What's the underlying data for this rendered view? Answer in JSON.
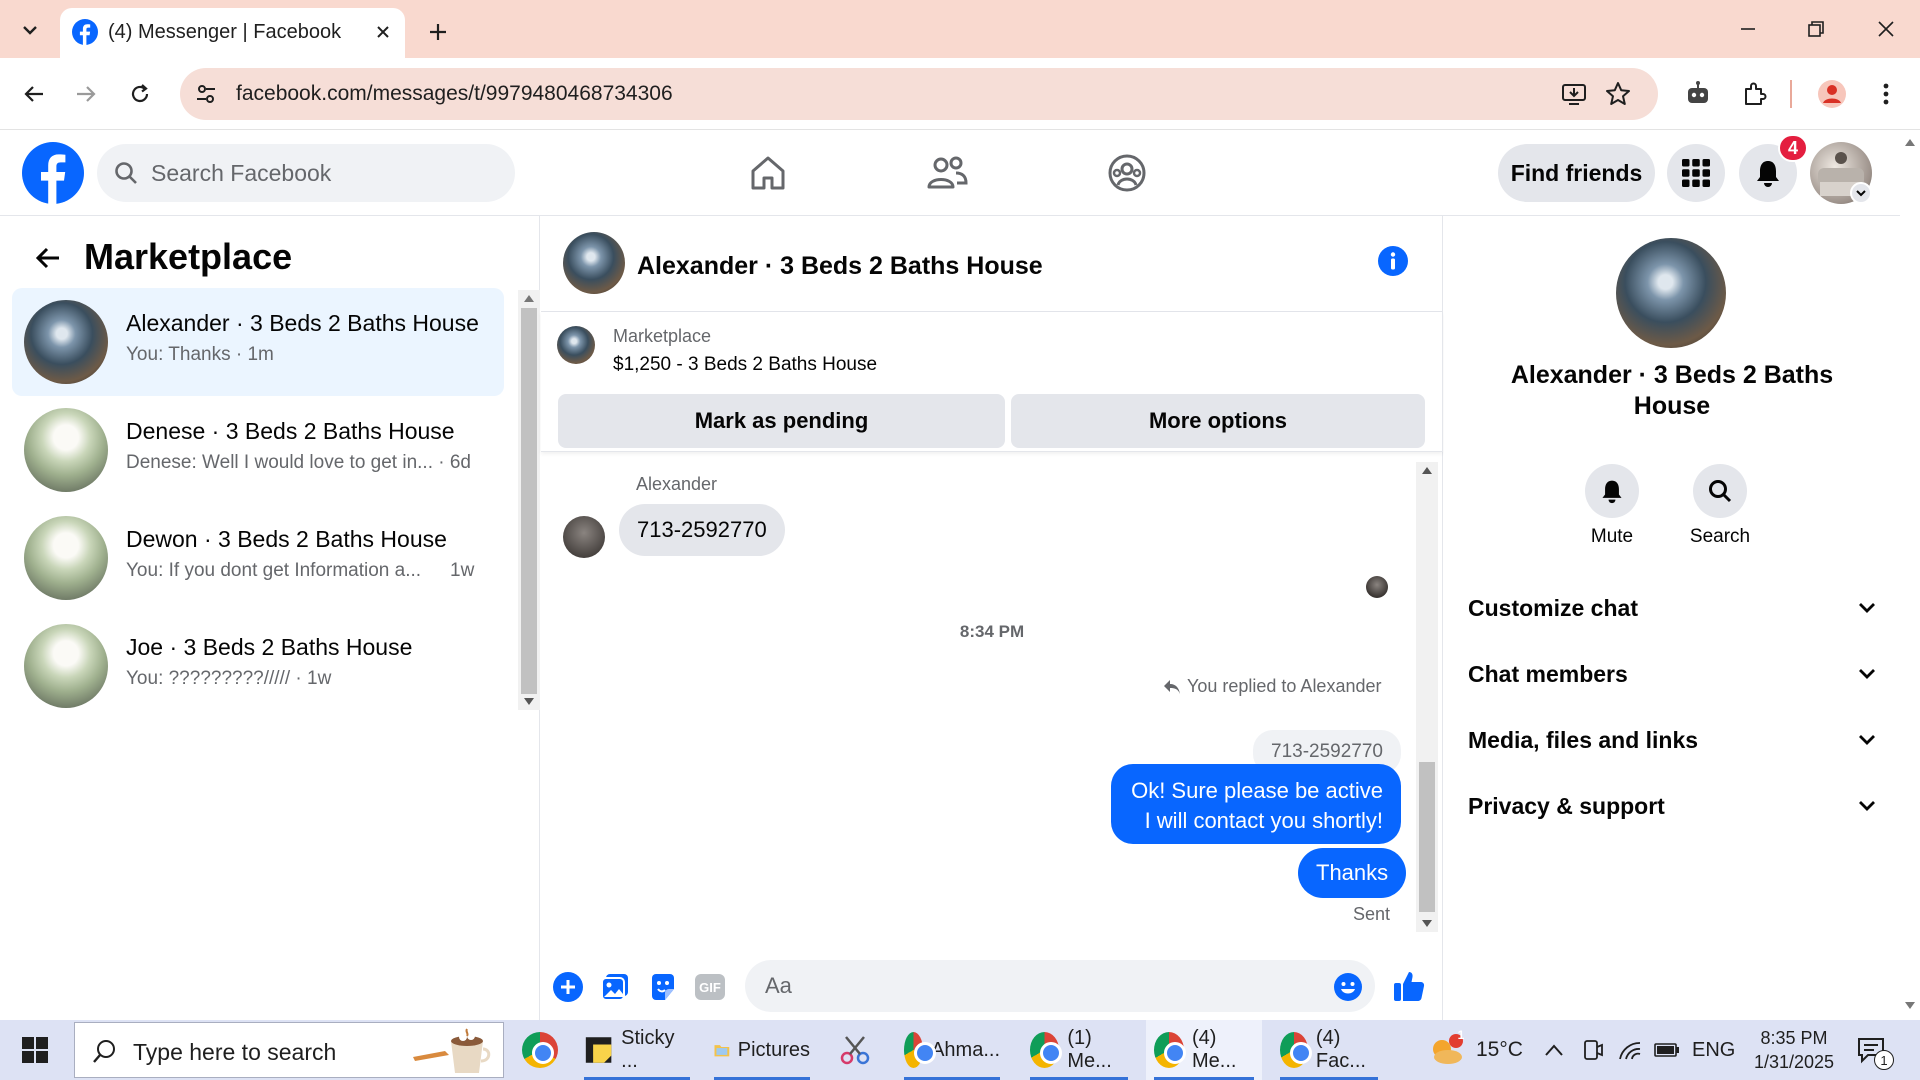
{
  "browser": {
    "tab_title": "(4) Messenger | Facebook",
    "url": "facebook.com/messages/t/9979480468734306"
  },
  "fb_header": {
    "search_placeholder": "Search Facebook",
    "find_friends": "Find friends",
    "notification_count": "4"
  },
  "left_panel": {
    "title": "Marketplace",
    "conversations": [
      {
        "name": "Alexander · 3 Beds 2 Baths House",
        "preview": "You: Thanks · 1m",
        "active": true
      },
      {
        "name": "Denese · 3 Beds 2 Baths House",
        "preview": "Denese: Well I would love to get in... · 6d",
        "active": false
      },
      {
        "name": "Dewon · 3 Beds 2 Baths House",
        "preview": "You: If you dont get Information a...",
        "time": "1w",
        "active": false
      },
      {
        "name": "Joe · 3 Beds 2 Baths House",
        "preview": "You: ?????????///// · 1w",
        "active": false
      }
    ]
  },
  "chat": {
    "title": "Alexander · 3 Beds 2 Baths House",
    "listing_label": "Marketplace",
    "listing_price": "$1,250 - 3 Beds 2 Baths House",
    "mark_pending": "Mark as pending",
    "more_options": "More options",
    "sender_name": "Alexander",
    "incoming_message": "713-2592770",
    "timestamp": "8:34 PM",
    "replied_label": "You replied to Alexander",
    "quoted_message": "713-2592770",
    "outgoing_line1": "Ok! Sure please be active",
    "outgoing_line2": "I will contact you shortly!",
    "outgoing_thanks": "Thanks",
    "status": "Sent",
    "input_placeholder": "Aa",
    "gif_label": "GIF"
  },
  "right_panel": {
    "name": "Alexander · 3 Beds 2 Baths House",
    "mute": "Mute",
    "search": "Search",
    "sections": [
      "Customize chat",
      "Chat members",
      "Media, files and links",
      "Privacy & support"
    ]
  },
  "taskbar": {
    "search_placeholder": "Type here to search",
    "apps": [
      "Sticky ...",
      "Pictures",
      "Ahma...",
      "(1) Me...",
      "(4) Me...",
      "(4) Fac..."
    ],
    "temperature": "15°C",
    "language": "ENG",
    "time": "8:35 PM",
    "date": "1/31/2025",
    "notification_count": "1"
  },
  "colors": {
    "brand": "#0866ff",
    "tab_bar": "#f9d9cf",
    "badge": "#e41e3f"
  }
}
